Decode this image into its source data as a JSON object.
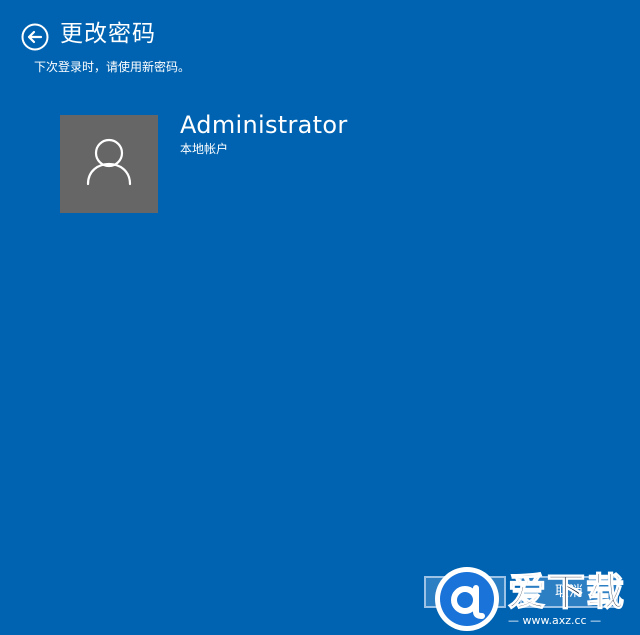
{
  "header": {
    "back_icon": "arrow-left-circle-icon",
    "title": "更改密码",
    "subtitle": "下次登录时，请使用新密码。"
  },
  "user": {
    "avatar_icon": "user-silhouette-icon",
    "name": "Administrator",
    "account_type": "本地帐户"
  },
  "footer": {
    "next_label": "完成",
    "cancel_label": "取消"
  },
  "watermark": {
    "logo_icon": "axz-logo-icon",
    "brand": "爱下载",
    "url": "— www.axz.cc —"
  },
  "colors": {
    "background": "#0063b1",
    "avatar_background": "#666666",
    "text": "#ffffff"
  }
}
